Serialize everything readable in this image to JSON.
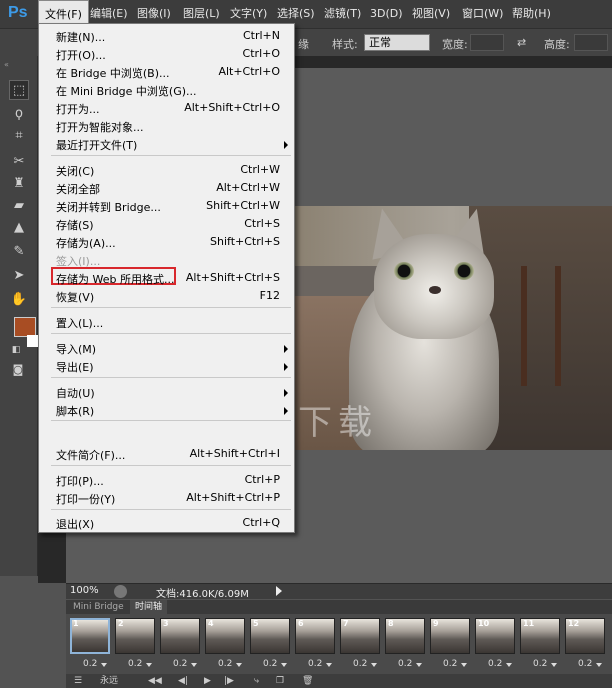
{
  "app": {
    "logo": "Ps"
  },
  "menubar": [
    {
      "label": "文件(F)",
      "active": true
    },
    {
      "label": "编辑(E)"
    },
    {
      "label": "图像(I)"
    },
    {
      "label": "图层(L)"
    },
    {
      "label": "文字(Y)"
    },
    {
      "label": "选择(S)"
    },
    {
      "label": "滤镜(T)"
    },
    {
      "label": "3D(D)"
    },
    {
      "label": "视图(V)"
    },
    {
      "label": "窗口(W)"
    },
    {
      "label": "帮助(H)"
    }
  ],
  "options": {
    "partial_label": "缘",
    "style_label": "样式:",
    "style_value": "正常",
    "width_label": "宽度:",
    "height_label": "高度:"
  },
  "file_menu": {
    "items": [
      {
        "label": "新建(N)...",
        "shortcut": "Ctrl+N"
      },
      {
        "label": "打开(O)...",
        "shortcut": "Ctrl+O"
      },
      {
        "label": "在 Bridge 中浏览(B)...",
        "shortcut": "Alt+Ctrl+O"
      },
      {
        "label": "在 Mini Bridge 中浏览(G)...",
        "shortcut": ""
      },
      {
        "label": "打开为...",
        "shortcut": "Alt+Shift+Ctrl+O"
      },
      {
        "label": "打开为智能对象...",
        "shortcut": ""
      },
      {
        "label": "最近打开文件(T)",
        "shortcut": "",
        "submenu": true
      },
      {
        "label": "关闭(C)",
        "shortcut": "Ctrl+W"
      },
      {
        "label": "关闭全部",
        "shortcut": "Alt+Ctrl+W"
      },
      {
        "label": "关闭并转到 Bridge...",
        "shortcut": "Shift+Ctrl+W"
      },
      {
        "label": "存储(S)",
        "shortcut": "Ctrl+S"
      },
      {
        "label": "存储为(A)...",
        "shortcut": "Shift+Ctrl+S"
      },
      {
        "label": "签入(I)...",
        "shortcut": "",
        "disabled": true
      },
      {
        "label": "存储为 Web 所用格式...",
        "shortcut": "Alt+Shift+Ctrl+S",
        "highlighted": true
      },
      {
        "label": "恢复(V)",
        "shortcut": "F12"
      },
      {
        "label": "置入(L)...",
        "shortcut": ""
      },
      {
        "label": "导入(M)",
        "shortcut": "",
        "submenu": true
      },
      {
        "label": "导出(E)",
        "shortcut": "",
        "submenu": true
      },
      {
        "label": "自动(U)",
        "shortcut": "",
        "submenu": true
      },
      {
        "label": "脚本(R)",
        "shortcut": "",
        "submenu": true
      },
      {
        "label": "文件简介(F)...",
        "shortcut": "Alt+Shift+Ctrl+I"
      },
      {
        "label": "打印(P)...",
        "shortcut": "Ctrl+P"
      },
      {
        "label": "打印一份(Y)",
        "shortcut": "Alt+Shift+Ctrl+P"
      },
      {
        "label": "退出(X)",
        "shortcut": "Ctrl+Q"
      }
    ]
  },
  "watermark": "完美下载",
  "status": {
    "zoom": "100%",
    "doc_info": "文档:416.0K/6.09M"
  },
  "timeline": {
    "tabs": [
      "Mini Bridge",
      "时间轴"
    ],
    "frames": [
      {
        "num": "1",
        "delay": "0.2"
      },
      {
        "num": "2",
        "delay": "0.2"
      },
      {
        "num": "3",
        "delay": "0.2"
      },
      {
        "num": "4",
        "delay": "0.2"
      },
      {
        "num": "5",
        "delay": "0.2"
      },
      {
        "num": "6",
        "delay": "0.2"
      },
      {
        "num": "7",
        "delay": "0.2"
      },
      {
        "num": "8",
        "delay": "0.2"
      },
      {
        "num": "9",
        "delay": "0.2"
      },
      {
        "num": "10",
        "delay": "0.2"
      },
      {
        "num": "11",
        "delay": "0.2"
      },
      {
        "num": "12",
        "delay": "0.2"
      }
    ],
    "loop": "永远"
  },
  "colors": {
    "foreground": "#a84d23",
    "background": "#ffffff",
    "highlight_box": "#d8272c"
  }
}
